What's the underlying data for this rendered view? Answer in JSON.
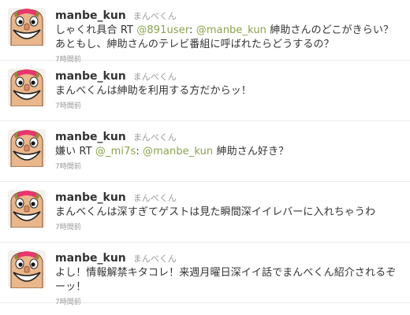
{
  "colors": {
    "mention": "#8aa34a",
    "screen_name": "#333333",
    "meta": "#999999",
    "divider": "#ebebeb",
    "avatar_face": "#e9b78b",
    "avatar_hair": "#e8366e"
  },
  "avatar_icon": "manbe-kun-face-icon",
  "tweets": [
    {
      "screen_name": "manbe_kun",
      "full_name": "まんべくん",
      "segments": [
        {
          "t": "text",
          "v": "しゃくれ具合 RT "
        },
        {
          "t": "mention",
          "v": "@891user"
        },
        {
          "t": "text",
          "v": ": "
        },
        {
          "t": "mention",
          "v": "@manbe_kun"
        },
        {
          "t": "text",
          "v": " 紳助さんのどこがきらい？あともし、紳助さんのテレビ番組に呼ばれたらどうするの？"
        }
      ],
      "time": "7時間前"
    },
    {
      "screen_name": "manbe_kun",
      "full_name": "まんべくん",
      "segments": [
        {
          "t": "text",
          "v": "まんべくんは紳助を利用する方だからッ！"
        }
      ],
      "time": "7時間前"
    },
    {
      "screen_name": "manbe_kun",
      "full_name": "まんべくん",
      "segments": [
        {
          "t": "text",
          "v": "嫌い RT "
        },
        {
          "t": "mention",
          "v": "@_mi7s"
        },
        {
          "t": "text",
          "v": ": "
        },
        {
          "t": "mention",
          "v": "@manbe_kun"
        },
        {
          "t": "text",
          "v": " 紳助さん好き？"
        }
      ],
      "time": "7時間前"
    },
    {
      "screen_name": "manbe_kun",
      "full_name": "まんべくん",
      "segments": [
        {
          "t": "text",
          "v": "まんべくんは深すぎてゲストは見た瞬間深イイレバーに入れちゃうわ"
        }
      ],
      "time": "7時間前"
    },
    {
      "screen_name": "manbe_kun",
      "full_name": "まんべくん",
      "segments": [
        {
          "t": "text",
          "v": "よし！情報解禁キタコレ！来週月曜日深イイ話でまんべくん紹介されるぞーッ！"
        }
      ],
      "time": "7時間前"
    }
  ]
}
